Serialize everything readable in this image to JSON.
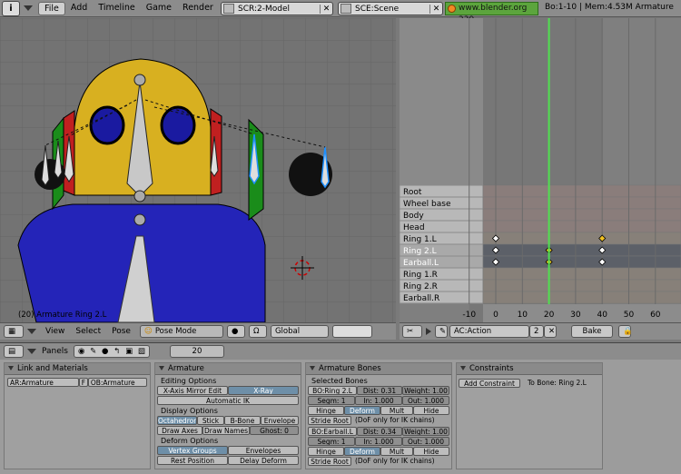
{
  "topbar": {
    "info_label": "i",
    "menus": [
      "File",
      "Add",
      "Timeline",
      "Game",
      "Render",
      "Help"
    ],
    "active_menu": "File",
    "screen": "SCR:2-Model",
    "scene": "SCE:Scene",
    "site": "www.blender.org 239",
    "stats": "Bo:1-10 | Mem:4.53M Armature"
  },
  "viewport": {
    "status": "(20) Armature Ring 2.L"
  },
  "view3d_header": {
    "menus": [
      "View",
      "Select",
      "Pose"
    ],
    "mode": "Pose Mode",
    "orientation": "Global"
  },
  "action_editor": {
    "channels": [
      "Root",
      "Wheel base",
      "Body",
      "Head",
      "Ring 1.L",
      "Ring 2.L",
      "Earball.L",
      "Ring 1.R",
      "Ring 2.R",
      "Earball.R"
    ],
    "selected_channels": [
      "Ring 2.L",
      "Earball.L"
    ],
    "ruler": [
      "-10",
      "0",
      "10",
      "20",
      "30",
      "40",
      "50",
      "60"
    ],
    "current_frame_value": 20,
    "action_name": "AC:Action",
    "action_users": "2",
    "bake_label": "Bake",
    "keys": [
      {
        "channel": "Ring 1.L",
        "frames": [
          0,
          40
        ]
      },
      {
        "channel": "Ring 2.L",
        "frames": [
          0,
          20,
          40
        ]
      },
      {
        "channel": "Earball.L",
        "frames": [
          0,
          20,
          40
        ]
      }
    ]
  },
  "buttons_header": {
    "panels_label": "Panels",
    "frame": "20"
  },
  "link_materials": {
    "title": "Link and Materials",
    "ar": "AR:Armature",
    "f": "F",
    "ob": "OB:Armature"
  },
  "armature_panel": {
    "title": "Armature",
    "editing_options": "Editing Options",
    "x_axis_mirror": "X-Axis Mirror Edit",
    "x_ray": "X-Ray",
    "automatic_ik": "Automatic IK",
    "display_options": "Display Options",
    "display_buttons": [
      "Octahedron",
      "Stick",
      "B-Bone",
      "Envelope"
    ],
    "draw_axes": "Draw Axes",
    "draw_names": "Draw Names",
    "ghost": "Ghost: 0",
    "deform_options": "Deform Options",
    "vertex_groups": "Vertex Groups",
    "envelopes": "Envelopes",
    "rest_position": "Rest Position",
    "delay_deform": "Delay Deform"
  },
  "armature_bones": {
    "title": "Armature Bones",
    "selected_bones": "Selected Bones",
    "bones": [
      {
        "name": "BO:Ring 2.L",
        "dist": "Dist: 0.31",
        "weight": "Weight: 1.00",
        "segm": "Segm: 1",
        "in": "In: 1.000",
        "out": "Out: 1.000"
      },
      {
        "name": "BO:Earball.L",
        "dist": "Dist: 0.34",
        "weight": "Weight: 1.00",
        "segm": "Segm: 1",
        "in": "In: 1.000",
        "out": "Out: 1.000"
      }
    ],
    "hinge": "Hinge",
    "deform": "Deform",
    "mult": "Mult",
    "hide": "Hide",
    "stride_root": "Stride Root",
    "dof_note": "(DoF only for IK chains)"
  },
  "constraints": {
    "title": "Constraints",
    "add_label": "Add Constraint",
    "to_bone": "To Bone: Ring 2.L"
  }
}
